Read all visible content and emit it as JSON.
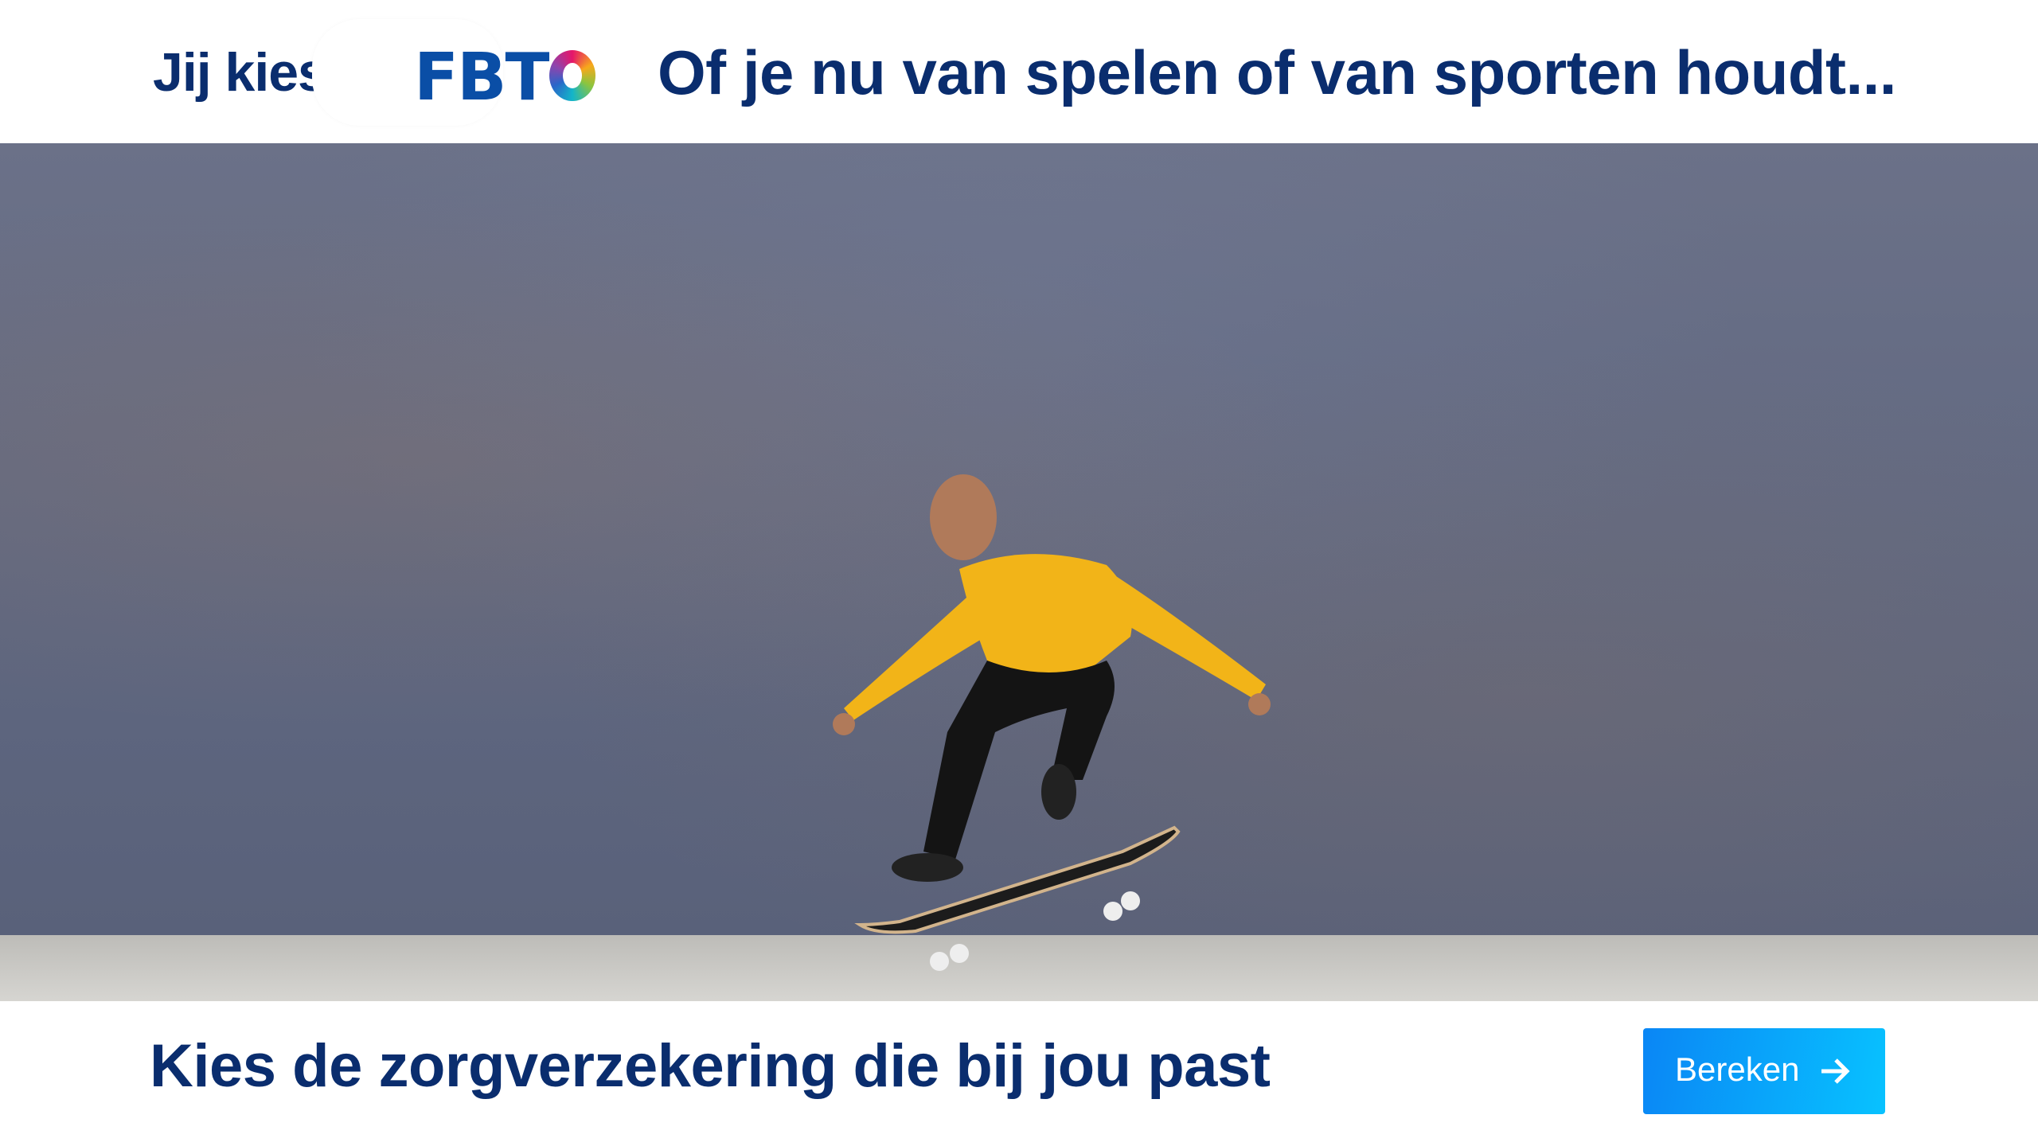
{
  "header": {
    "tagline": "Jij kiest.",
    "logo_text": "FBTO",
    "headline": "Of je nu van spelen of van sporten houdt..."
  },
  "hero": {
    "image": "skateboarder-jumping-icon"
  },
  "footer": {
    "cta_text": "Kies de zorgverzekering die bij jou past",
    "button_label": "Bereken",
    "button_icon": "arrow-right-icon"
  },
  "colors": {
    "brand_navy": "#0a2d6e",
    "button_start": "#0a86f5",
    "button_end": "#08c2ff"
  }
}
